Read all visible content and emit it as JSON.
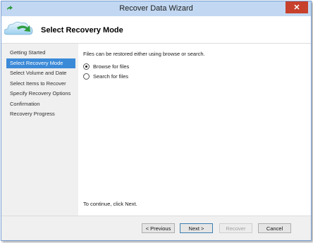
{
  "window": {
    "title": "Recover Data Wizard",
    "close_glyph": "✕"
  },
  "header": {
    "title": "Select Recovery Mode",
    "icon": "cloud-recovery-icon"
  },
  "sidebar": {
    "steps": [
      {
        "label": "Getting Started"
      },
      {
        "label": "Select Recovery Mode",
        "active": true
      },
      {
        "label": "Select Volume and Date"
      },
      {
        "label": "Select Items to Recover"
      },
      {
        "label": "Specify Recovery Options"
      },
      {
        "label": "Confirmation"
      },
      {
        "label": "Recovery Progress"
      }
    ]
  },
  "main": {
    "intro": "Files can be restored either using browse or search.",
    "options": [
      {
        "label": "Browse for files",
        "selected": true
      },
      {
        "label": "Search for files",
        "selected": false
      }
    ],
    "continue_text": "To continue, click Next."
  },
  "footer": {
    "previous": "< Previous",
    "next": "Next >",
    "recover": "Recover",
    "cancel": "Cancel"
  },
  "colors": {
    "titlebar": "#c2d8f2",
    "close_button": "#c7412c",
    "active_step": "#3b8ad8"
  }
}
